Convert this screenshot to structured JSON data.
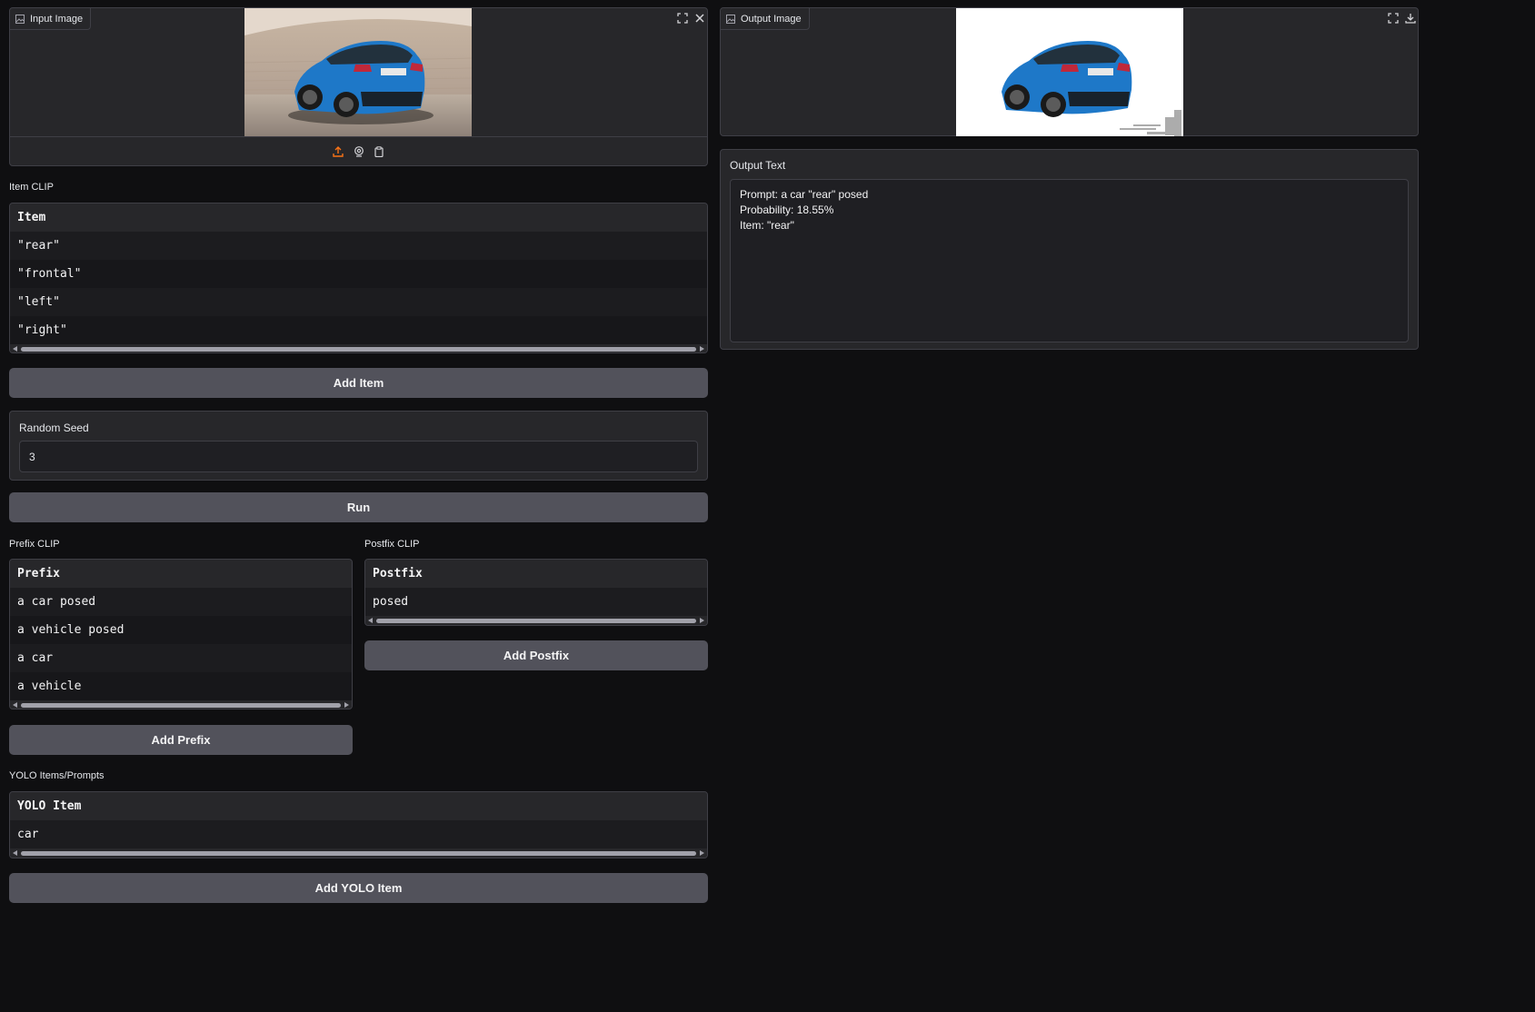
{
  "input_image": {
    "label": "Input Image",
    "icons": [
      "image-icon",
      "fullscreen-icon",
      "close-icon",
      "upload-icon",
      "webcam-icon",
      "clipboard-icon"
    ]
  },
  "output_image": {
    "label": "Output Image",
    "icons": [
      "image-icon",
      "fullscreen-icon",
      "download-icon"
    ]
  },
  "output_text": {
    "label": "Output Text",
    "lines": [
      "Prompt: a car \"rear\" posed",
      "Probability: 18.55%",
      "Item: \"rear\""
    ]
  },
  "item_clip": {
    "label": "Item CLIP",
    "header": "Item",
    "rows": [
      "\"rear\"",
      "\"frontal\"",
      "\"left\"",
      "\"right\""
    ]
  },
  "add_item_label": "Add Item",
  "random_seed": {
    "label": "Random Seed",
    "value": "3"
  },
  "run_label": "Run",
  "prefix_clip": {
    "label": "Prefix CLIP",
    "header": "Prefix",
    "rows": [
      "a car posed",
      "a vehicle posed",
      "a car",
      "a vehicle"
    ]
  },
  "add_prefix_label": "Add Prefix",
  "postfix_clip": {
    "label": "Postfix CLIP",
    "header": "Postfix",
    "rows": [
      "posed"
    ]
  },
  "add_postfix_label": "Add Postfix",
  "yolo": {
    "label": "YOLO Items/Prompts",
    "header": "YOLO Item",
    "rows": [
      "car"
    ]
  },
  "add_yolo_label": "Add YOLO Item",
  "colors": {
    "accent": "#f97316",
    "car_blue": "#1e78c8",
    "button_bg": "#52525b",
    "panel_bg": "#27272a"
  }
}
